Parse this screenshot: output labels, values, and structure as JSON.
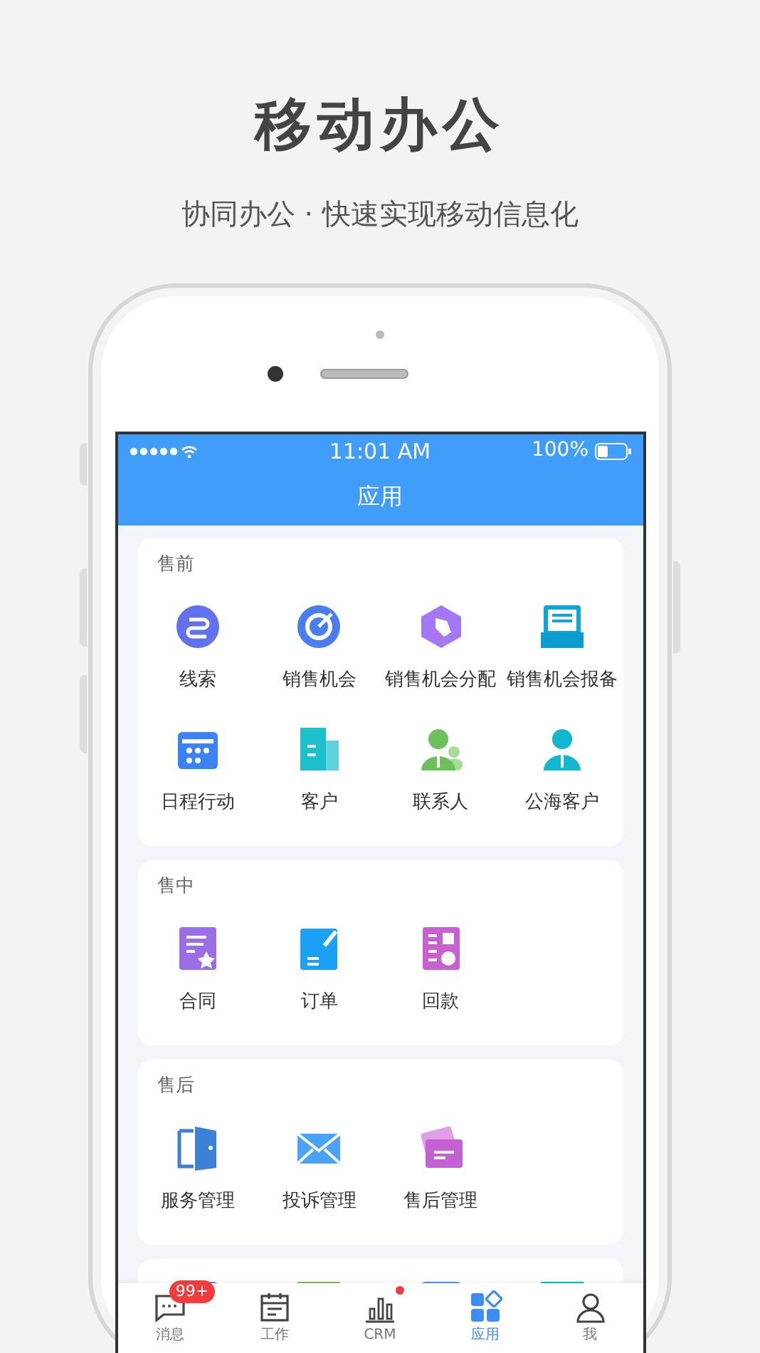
{
  "header": {
    "title": "移动办公",
    "subtitle": "协同办公 · 快速实现移动信息化"
  },
  "status_bar": {
    "time": "11:01 AM",
    "battery": "100%"
  },
  "nav_bar": {
    "title": "应用"
  },
  "sections": [
    {
      "title": "售前",
      "items": [
        {
          "label": "线索"
        },
        {
          "label": "销售机会"
        },
        {
          "label": "销售机会分配"
        },
        {
          "label": "销售机会报备"
        },
        {
          "label": "日程行动"
        },
        {
          "label": "客户"
        },
        {
          "label": "联系人"
        },
        {
          "label": "公海客户"
        }
      ]
    },
    {
      "title": "售中",
      "items": [
        {
          "label": "合同"
        },
        {
          "label": "订单"
        },
        {
          "label": "回款"
        }
      ]
    },
    {
      "title": "售后",
      "items": [
        {
          "label": "服务管理"
        },
        {
          "label": "投诉管理"
        },
        {
          "label": "售后管理"
        }
      ]
    }
  ],
  "tabs": [
    {
      "label": "消息",
      "selected": false,
      "badge": "99+",
      "dot": false
    },
    {
      "label": "工作",
      "selected": false,
      "dot": false
    },
    {
      "label": "CRM",
      "selected": false,
      "dot": true
    },
    {
      "label": "应用",
      "selected": true,
      "dot": false
    },
    {
      "label": "我",
      "selected": false,
      "dot": false
    }
  ]
}
